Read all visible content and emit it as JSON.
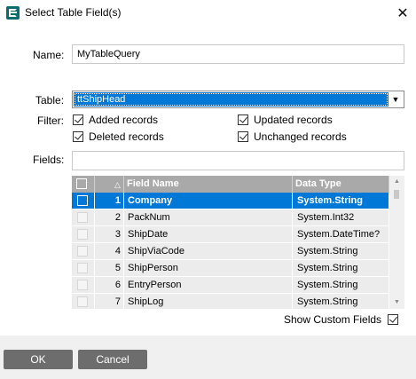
{
  "window": {
    "title": "Select Table Field(s)",
    "close_symbol": "✕"
  },
  "form": {
    "name_label": "Name:",
    "name_value": "MyTableQuery",
    "table_label": "Table:",
    "table_value": "ttShipHead",
    "filter_label": "Filter:",
    "filters": [
      {
        "label": "Added records",
        "checked": true
      },
      {
        "label": "Updated records",
        "checked": true
      },
      {
        "label": "Deleted records",
        "checked": true
      },
      {
        "label": "Unchanged records",
        "checked": true
      }
    ],
    "fields_label": "Fields:",
    "fields_value": ""
  },
  "grid": {
    "columns": {
      "sort_symbol": "△",
      "field_name": "Field Name",
      "data_type": "Data Type"
    },
    "rows": [
      {
        "num": "1",
        "name": "Company",
        "type": "System.String",
        "selected": true
      },
      {
        "num": "2",
        "name": "PackNum",
        "type": "System.Int32",
        "selected": false
      },
      {
        "num": "3",
        "name": "ShipDate",
        "type": "System.DateTime?",
        "selected": false
      },
      {
        "num": "4",
        "name": "ShipViaCode",
        "type": "System.String",
        "selected": false
      },
      {
        "num": "5",
        "name": "ShipPerson",
        "type": "System.String",
        "selected": false
      },
      {
        "num": "6",
        "name": "EntryPerson",
        "type": "System.String",
        "selected": false
      },
      {
        "num": "7",
        "name": "ShipLog",
        "type": "System.String",
        "selected": false
      }
    ]
  },
  "show_custom_fields": {
    "label": "Show Custom Fields",
    "checked": true
  },
  "buttons": {
    "ok": "OK",
    "cancel": "Cancel"
  },
  "colors": {
    "selection": "#0078d7",
    "button": "#6d6d6d",
    "grid_header": "#a9a9a9",
    "app_icon": "#0a6b73"
  }
}
